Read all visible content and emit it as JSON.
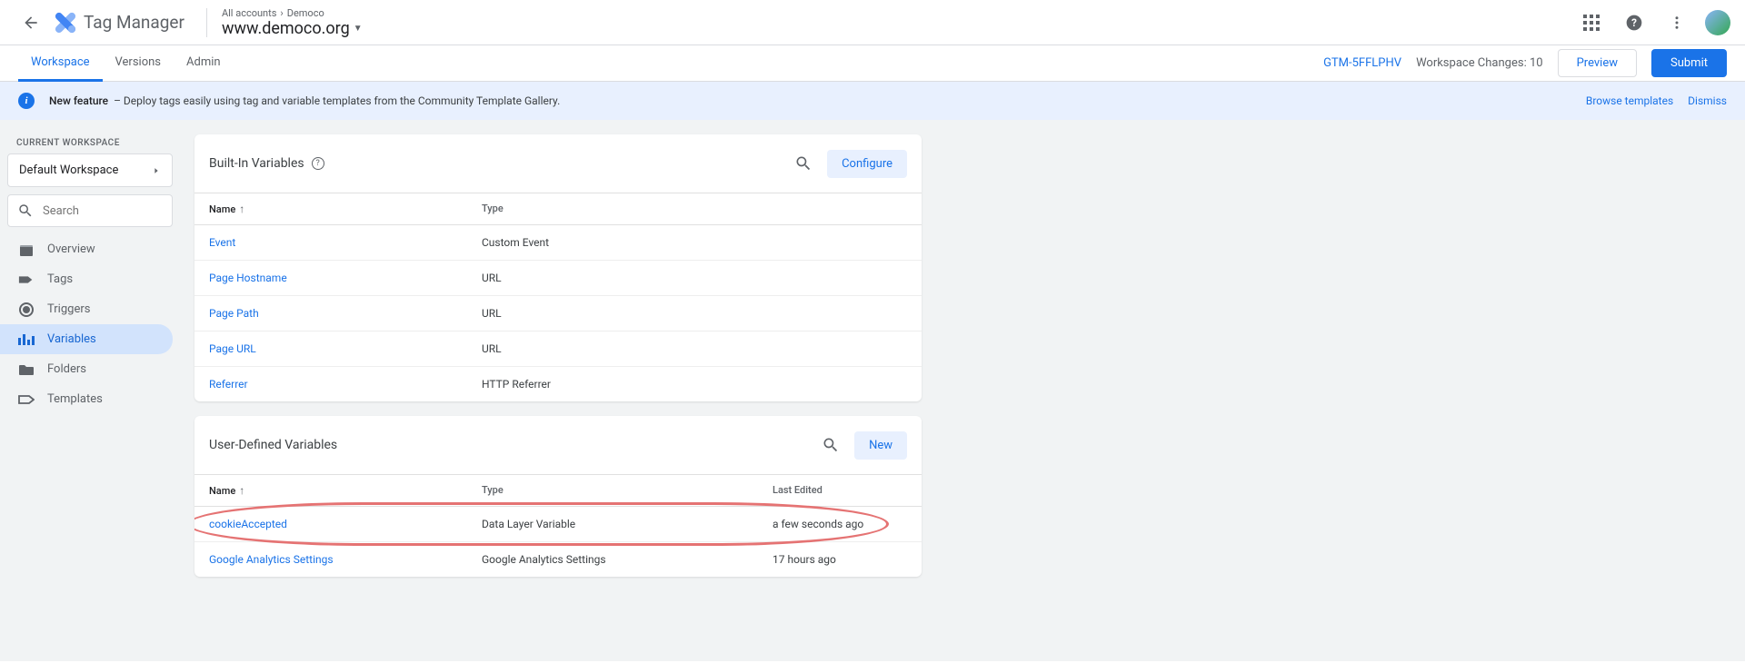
{
  "header": {
    "product": "Tag Manager",
    "breadcrumb1": "All accounts",
    "breadcrumb2": "Democo",
    "container": "www.democo.org"
  },
  "nav": {
    "tabs": [
      "Workspace",
      "Versions",
      "Admin"
    ],
    "container_id": "GTM-5FFLPHV",
    "changes": "Workspace Changes: 10",
    "preview": "Preview",
    "submit": "Submit"
  },
  "notif": {
    "title": "New feature",
    "text": "– Deploy tags easily using tag and variable templates from the Community Template Gallery.",
    "browse": "Browse templates",
    "dismiss": "Dismiss"
  },
  "sidebar": {
    "label": "CURRENT WORKSPACE",
    "workspace": "Default Workspace",
    "search_ph": "Search",
    "items": [
      "Overview",
      "Tags",
      "Triggers",
      "Variables",
      "Folders",
      "Templates"
    ]
  },
  "builtin": {
    "title": "Built-In Variables",
    "configure": "Configure",
    "cols": {
      "name": "Name",
      "type": "Type"
    },
    "rows": [
      {
        "name": "Event",
        "type": "Custom Event"
      },
      {
        "name": "Page Hostname",
        "type": "URL"
      },
      {
        "name": "Page Path",
        "type": "URL"
      },
      {
        "name": "Page URL",
        "type": "URL"
      },
      {
        "name": "Referrer",
        "type": "HTTP Referrer"
      }
    ]
  },
  "user": {
    "title": "User-Defined Variables",
    "new": "New",
    "cols": {
      "name": "Name",
      "type": "Type",
      "edited": "Last Edited"
    },
    "rows": [
      {
        "name": "cookieAccepted",
        "type": "Data Layer Variable",
        "edited": "a few seconds ago"
      },
      {
        "name": "Google Analytics Settings",
        "type": "Google Analytics Settings",
        "edited": "17 hours ago"
      }
    ]
  }
}
